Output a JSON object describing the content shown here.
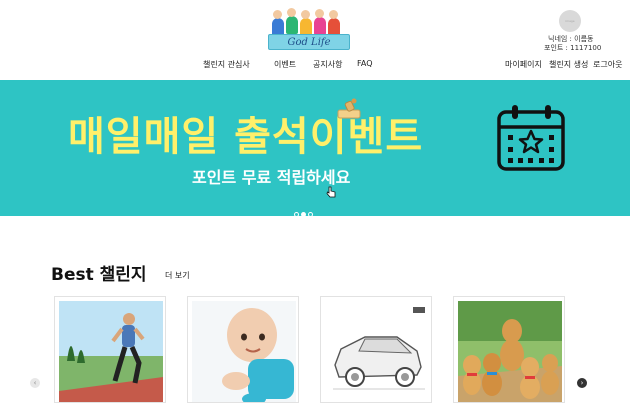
{
  "header": {
    "logo_text": "God Life",
    "nav": [
      "챌린지 관심사",
      "이벤트",
      "공지사항",
      "FAQ"
    ],
    "profile": {
      "avatar_text": "image",
      "nickname": "닉네임 : 이름동",
      "points": "포인트 : 1117100"
    },
    "user_links": [
      "마이페이지",
      "챌린지 생성",
      "로그아웃"
    ]
  },
  "banner": {
    "title": "매일매일 출석이벤트",
    "subtitle": "포인트 무료 적립하세요",
    "slide_count": 3,
    "active_slide": 1,
    "title_color": "#fff06a",
    "background": "#2ec4c4"
  },
  "best": {
    "title": "Best 챌린지",
    "more": "더 보기",
    "cards": [
      {
        "image": "running-man-photo"
      },
      {
        "image": "crawling-baby-photo"
      },
      {
        "image": "car-sketch-photo"
      },
      {
        "image": "golden-puppies-photo"
      }
    ]
  }
}
